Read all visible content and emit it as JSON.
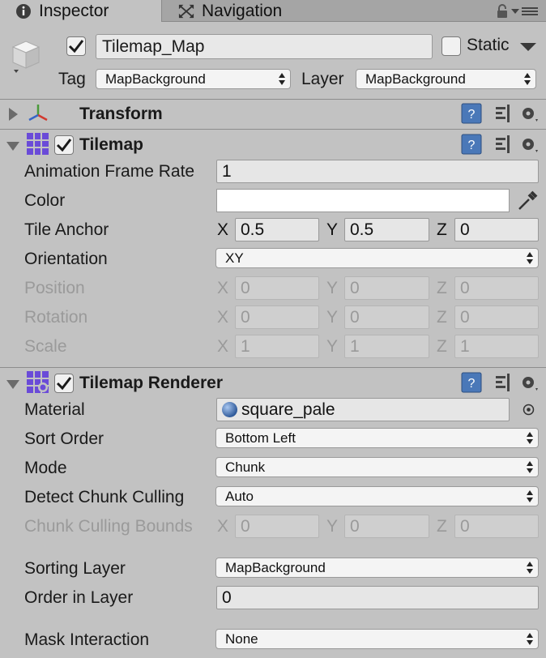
{
  "tabs": [
    {
      "label": "Inspector",
      "icon": "info-icon"
    },
    {
      "label": "Navigation",
      "icon": "navigation-icon"
    }
  ],
  "header": {
    "name": "Tilemap_Map",
    "active": true,
    "static_label": "Static",
    "static_checked": false,
    "tag_label": "Tag",
    "tag_value": "MapBackground",
    "layer_label": "Layer",
    "layer_value": "MapBackground"
  },
  "transform": {
    "title": "Transform",
    "expanded": false
  },
  "tilemap": {
    "title": "Tilemap",
    "enabled": true,
    "animation_frame_rate_label": "Animation Frame Rate",
    "animation_frame_rate": "1",
    "color_label": "Color",
    "color_value": "#ffffff",
    "tile_anchor_label": "Tile Anchor",
    "tile_anchor": {
      "x": "0.5",
      "y": "0.5",
      "z": "0"
    },
    "orientation_label": "Orientation",
    "orientation_value": "XY",
    "position_label": "Position",
    "position": {
      "x": "0",
      "y": "0",
      "z": "0"
    },
    "rotation_label": "Rotation",
    "rotation": {
      "x": "0",
      "y": "0",
      "z": "0"
    },
    "scale_label": "Scale",
    "scale": {
      "x": "1",
      "y": "1",
      "z": "1"
    }
  },
  "renderer": {
    "title": "Tilemap Renderer",
    "enabled": true,
    "material_label": "Material",
    "material_value": "square_pale",
    "sort_order_label": "Sort Order",
    "sort_order_value": "Bottom Left",
    "mode_label": "Mode",
    "mode_value": "Chunk",
    "detect_chunk_culling_label": "Detect Chunk Culling",
    "detect_chunk_culling_value": "Auto",
    "chunk_culling_bounds_label": "Chunk Culling Bounds",
    "chunk_culling_bounds": {
      "x": "0",
      "y": "0",
      "z": "0"
    },
    "sorting_layer_label": "Sorting Layer",
    "sorting_layer_value": "MapBackground",
    "order_in_layer_label": "Order in Layer",
    "order_in_layer_value": "0",
    "mask_interaction_label": "Mask Interaction",
    "mask_interaction_value": "None"
  },
  "axis_labels": {
    "x": "X",
    "y": "Y",
    "z": "Z"
  }
}
